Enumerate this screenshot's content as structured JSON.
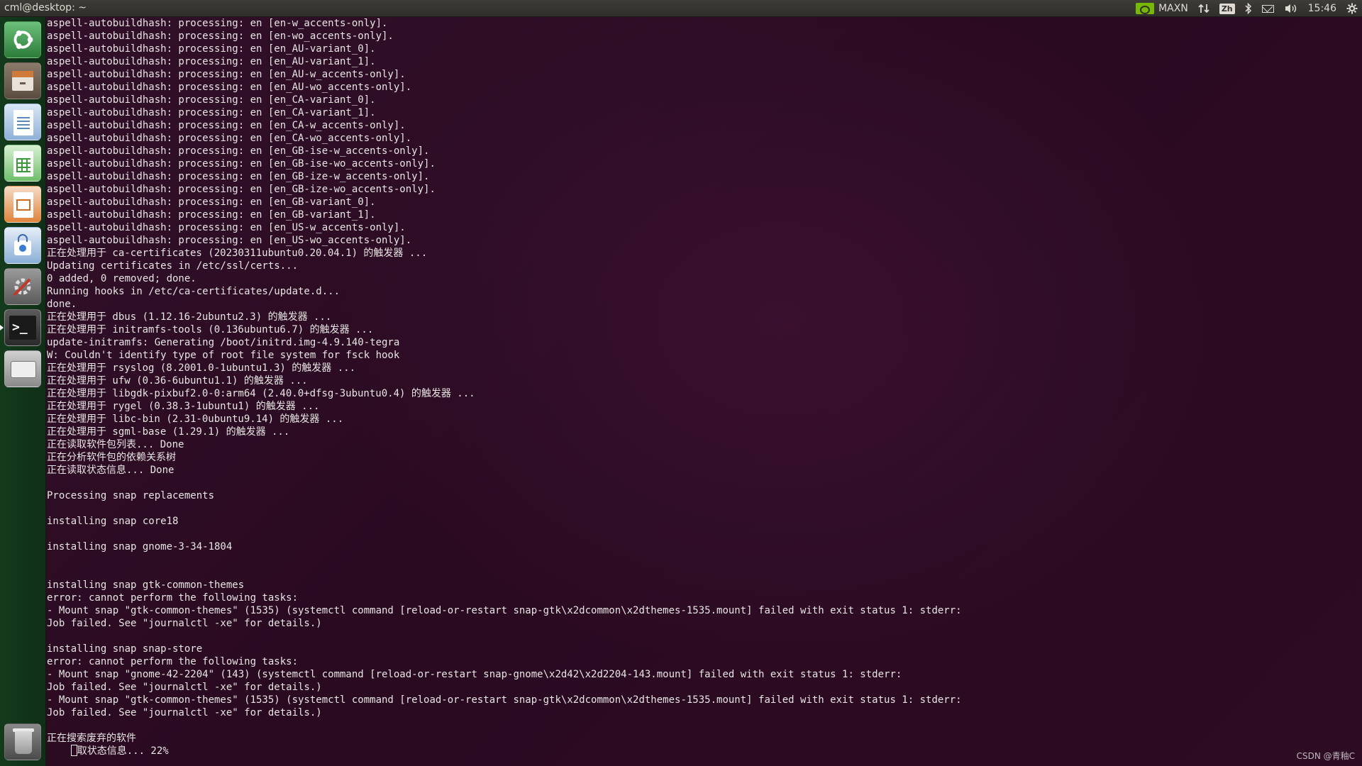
{
  "window_title": "cml@desktop: ~",
  "top_panel": {
    "power_mode": "MAXN",
    "input_method": "Zh",
    "clock": "15:46",
    "icons": [
      "nvidia-icon",
      "network-arrows-icon",
      "input-method-icon",
      "bluetooth-icon",
      "mail-icon",
      "volume-icon",
      "settings-gear-icon"
    ]
  },
  "launcher": {
    "items": [
      "dash",
      "files",
      "libreoffice-writer",
      "libreoffice-calc",
      "libreoffice-impress",
      "software-store",
      "system-settings",
      "terminal",
      "drive",
      "trash"
    ]
  },
  "terminal": {
    "lines": [
      "aspell-autobuildhash: processing: en [en-w_accents-only].",
      "aspell-autobuildhash: processing: en [en-wo_accents-only].",
      "aspell-autobuildhash: processing: en [en_AU-variant_0].",
      "aspell-autobuildhash: processing: en [en_AU-variant_1].",
      "aspell-autobuildhash: processing: en [en_AU-w_accents-only].",
      "aspell-autobuildhash: processing: en [en_AU-wo_accents-only].",
      "aspell-autobuildhash: processing: en [en_CA-variant_0].",
      "aspell-autobuildhash: processing: en [en_CA-variant_1].",
      "aspell-autobuildhash: processing: en [en_CA-w_accents-only].",
      "aspell-autobuildhash: processing: en [en_CA-wo_accents-only].",
      "aspell-autobuildhash: processing: en [en_GB-ise-w_accents-only].",
      "aspell-autobuildhash: processing: en [en_GB-ise-wo_accents-only].",
      "aspell-autobuildhash: processing: en [en_GB-ize-w_accents-only].",
      "aspell-autobuildhash: processing: en [en_GB-ize-wo_accents-only].",
      "aspell-autobuildhash: processing: en [en_GB-variant_0].",
      "aspell-autobuildhash: processing: en [en_GB-variant_1].",
      "aspell-autobuildhash: processing: en [en_US-w_accents-only].",
      "aspell-autobuildhash: processing: en [en_US-wo_accents-only].",
      "正在处理用于 ca-certificates (20230311ubuntu0.20.04.1) 的触发器 ...",
      "Updating certificates in /etc/ssl/certs...",
      "0 added, 0 removed; done.",
      "Running hooks in /etc/ca-certificates/update.d...",
      "done.",
      "正在处理用于 dbus (1.12.16-2ubuntu2.3) 的触发器 ...",
      "正在处理用于 initramfs-tools (0.136ubuntu6.7) 的触发器 ...",
      "update-initramfs: Generating /boot/initrd.img-4.9.140-tegra",
      "W: Couldn't identify type of root file system for fsck hook",
      "正在处理用于 rsyslog (8.2001.0-1ubuntu1.3) 的触发器 ...",
      "正在处理用于 ufw (0.36-6ubuntu1.1) 的触发器 ...",
      "正在处理用于 libgdk-pixbuf2.0-0:arm64 (2.40.0+dfsg-3ubuntu0.4) 的触发器 ...",
      "正在处理用于 rygel (0.38.3-1ubuntu1) 的触发器 ...",
      "正在处理用于 libc-bin (2.31-0ubuntu9.14) 的触发器 ...",
      "正在处理用于 sgml-base (1.29.1) 的触发器 ...",
      "正在读取软件包列表... Done",
      "正在分析软件包的依赖关系树",
      "正在读取状态信息... Done",
      "",
      "Processing snap replacements",
      "",
      "installing snap core18",
      "",
      "installing snap gnome-3-34-1804",
      "",
      "",
      "installing snap gtk-common-themes",
      "error: cannot perform the following tasks:",
      "- Mount snap \"gtk-common-themes\" (1535) (systemctl command [reload-or-restart snap-gtk\\x2dcommon\\x2dthemes-1535.mount] failed with exit status 1: stderr:",
      "Job failed. See \"journalctl -xe\" for details.)",
      "",
      "installing snap snap-store",
      "error: cannot perform the following tasks:",
      "- Mount snap \"gnome-42-2204\" (143) (systemctl command [reload-or-restart snap-gnome\\x2d42\\x2d2204-143.mount] failed with exit status 1: stderr:",
      "Job failed. See \"journalctl -xe\" for details.)",
      "- Mount snap \"gtk-common-themes\" (1535) (systemctl command [reload-or-restart snap-gtk\\x2dcommon\\x2dthemes-1535.mount] failed with exit status 1: stderr:",
      "Job failed. See \"journalctl -xe\" for details.)",
      "",
      "正在搜索废弃的软件"
    ],
    "progress_prefix": "    ",
    "progress_text": "取状态信息... 22%"
  },
  "watermark": "CSDN @青釉C"
}
